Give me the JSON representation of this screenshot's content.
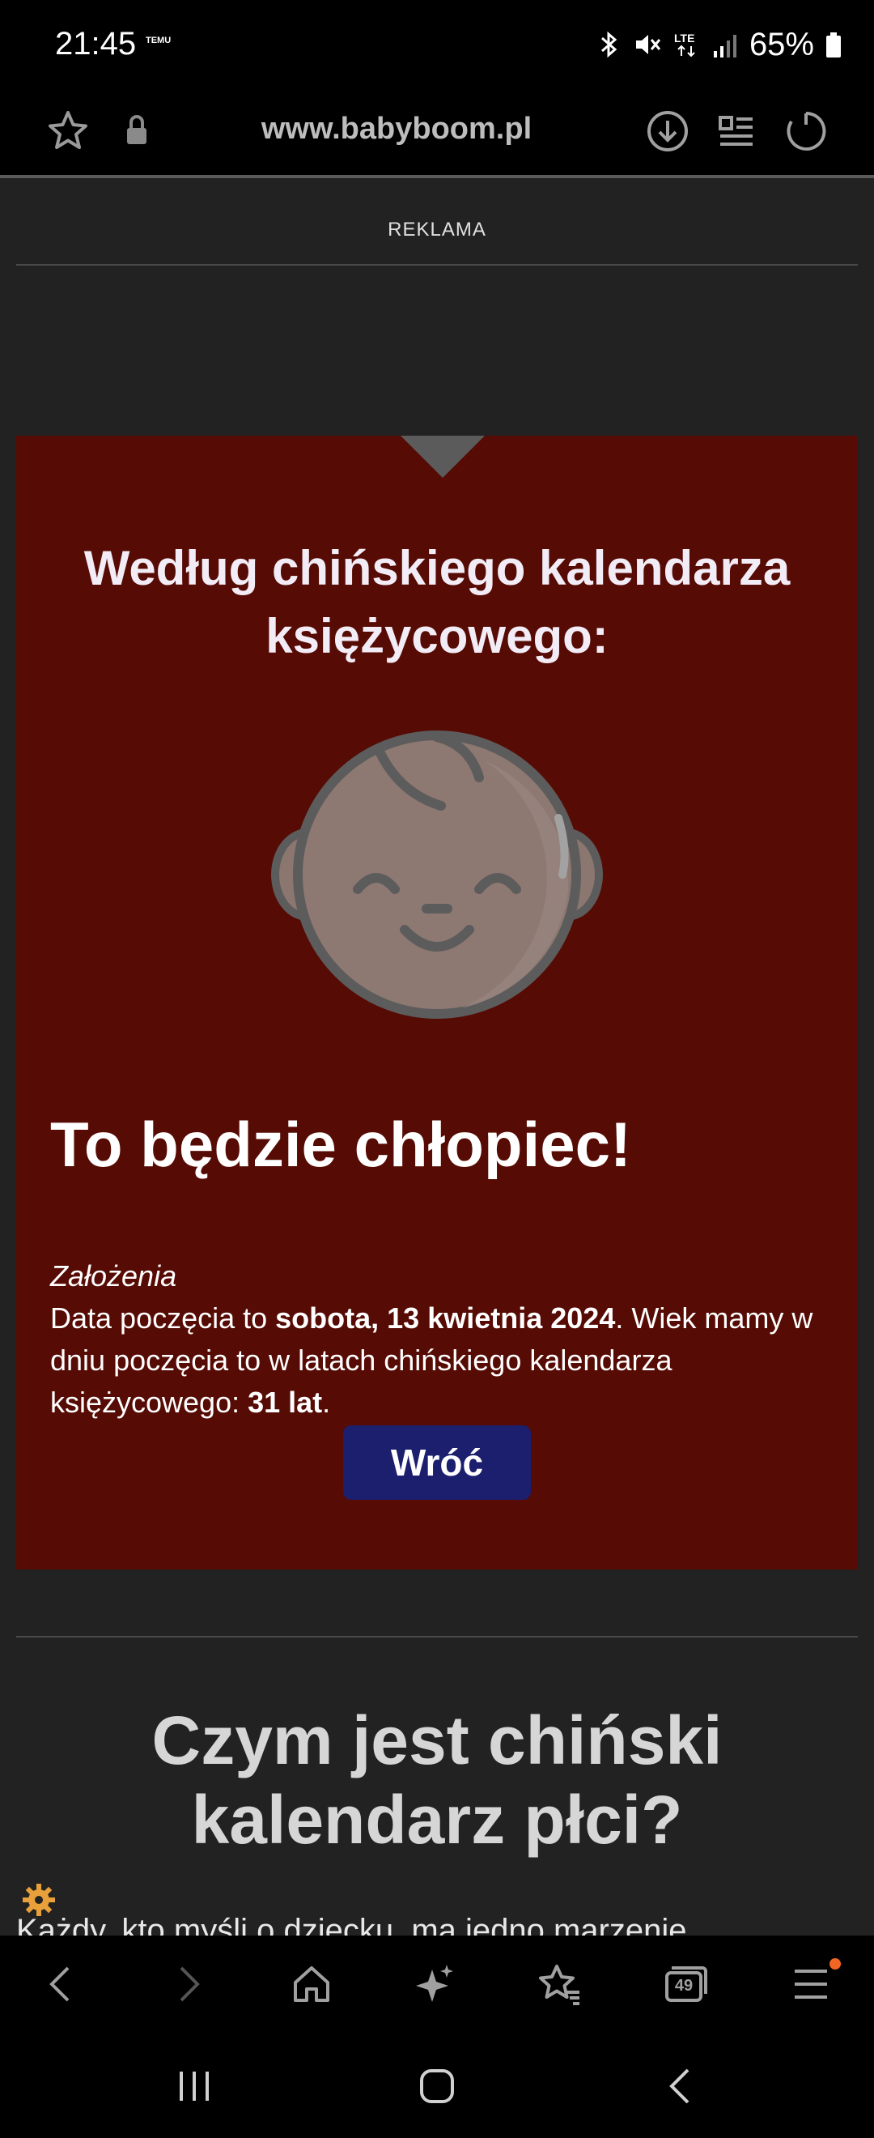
{
  "status_bar": {
    "time": "21:45",
    "notification_label": "TEMU",
    "battery": "65%",
    "icons": [
      "bluetooth-icon",
      "mute-icon",
      "lte-icon",
      "signal-icon",
      "battery-icon"
    ]
  },
  "browser": {
    "url": "www.babyboom.pl",
    "icons": [
      "bookmark-star-icon",
      "lock-icon",
      "download-icon",
      "reader-mode-icon",
      "reload-icon"
    ]
  },
  "ad": {
    "label": "REKLAMA"
  },
  "result": {
    "heading": "Według chińskiego kalendarza księżycowego:",
    "main": "To będzie chłopiec!",
    "assumptions_label": "Założenia",
    "text_1": "Data poczęcia to ",
    "conception_date": "sobota, 13 kwietnia 2024",
    "text_2": ". Wiek mamy w dniu poczęcia to w latach chińskiego kalendarza księżycowego: ",
    "mother_age": "31 lat",
    "text_3": ".",
    "back_button": "Wróć"
  },
  "section": {
    "title": "Czym jest chiński kalendarz płci?",
    "text_preview": "Każdy, kto myśli o dziecku, ma jedno marzenie"
  },
  "toolbar": {
    "icons": [
      "back-icon",
      "forward-icon",
      "home-icon",
      "ai-sparkle-icon",
      "bookmarks-icon",
      "tabs-icon",
      "menu-icon"
    ],
    "tab_count": "49"
  },
  "colors": {
    "result_background": "#560b04",
    "button_background": "#1c1e6e",
    "page_background": "#222222",
    "notification_dot": "#f26522"
  }
}
